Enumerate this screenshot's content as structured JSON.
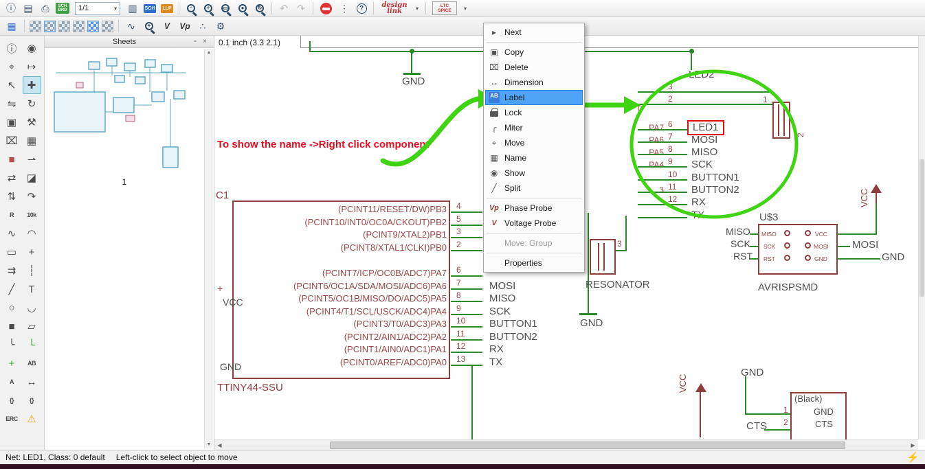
{
  "colors": {
    "wire_green": "#2a8a2a",
    "component_red": "#8f3e3e",
    "annotation_red": "#e01020",
    "highlight_green": "#3fd411",
    "menu_highlight_blue": "#4fa3f7"
  },
  "icons": {
    "caret": "▾",
    "bolt": "⚡",
    "scroll_up": "▲",
    "scroll_down": "▼",
    "scroll_left": "◀",
    "scroll_right": "▶",
    "panel_pin": "▫",
    "panel_close": "×"
  },
  "toolbar_top": {
    "icons_a": [
      {
        "g": "ⓘ",
        "n": "info-icon"
      },
      {
        "g": "▤",
        "n": "save-icon"
      },
      {
        "g": "⎙",
        "n": "print-icon"
      },
      {
        "g": "SCH BRD",
        "n": "sch-brd-icon",
        "cls": "schbrd"
      }
    ],
    "sheet_selector": "1/1",
    "icons_b": [
      {
        "g": "▥",
        "n": "columns-icon"
      },
      {
        "g": "SCH",
        "n": "sch-chip-icon",
        "cls": "chip chip-blue"
      },
      {
        "g": "LLP",
        "n": "llp-chip-icon",
        "cls": "chip chip-orange"
      }
    ],
    "icons_zoom": [
      {
        "g": "−",
        "n": "zoom-out-icon",
        "cls": "mag"
      },
      {
        "g": "+",
        "n": "zoom-in-icon",
        "cls": "mag"
      },
      {
        "g": "▭",
        "n": "zoom-window-icon",
        "cls": "mag"
      },
      {
        "g": "●",
        "n": "zoom-full-icon",
        "cls": "mag"
      },
      {
        "g": "↻",
        "n": "zoom-redraw-icon",
        "cls": "mag"
      }
    ],
    "icons_c": [
      {
        "g": "↶",
        "n": "undo-icon",
        "cls": "dis"
      },
      {
        "g": "↷",
        "n": "redo-icon",
        "cls": "dis"
      }
    ],
    "icons_d": [
      {
        "g": "",
        "n": "stop-icon",
        "cls": "stop"
      },
      {
        "g": "⋮",
        "n": "overflow-icon"
      },
      {
        "g": "?",
        "n": "help-icon",
        "cls": "help"
      }
    ],
    "design_link": "design link",
    "ltc_spice": "LTC SPICE"
  },
  "toolbar2": {
    "icons_a": [
      {
        "g": "▦",
        "n": "grid-icon",
        "cls": "blue"
      }
    ],
    "swatches": [
      {
        "n": "layer-view-1-icon"
      },
      {
        "n": "layer-view-2-icon",
        "cls": "pressed"
      },
      {
        "n": "layer-view-3-icon"
      },
      {
        "n": "layer-view-4-icon"
      },
      {
        "n": "layer-view-5-icon",
        "cls": "pressed sw-blue"
      },
      {
        "n": "layer-view-6-icon"
      }
    ],
    "icons_b": [
      {
        "g": "∿",
        "n": "signal-icon"
      },
      {
        "g": "+",
        "n": "zoom-probe-icon",
        "cls": "mag"
      },
      {
        "g": "V",
        "n": "voltage-probe-icon",
        "cls": "probe"
      },
      {
        "g": "Vp",
        "n": "phase-probe-icon",
        "cls": "probe"
      },
      {
        "g": "∴",
        "n": "chain-icon"
      },
      {
        "g": "⚙",
        "n": "settings-gear-icon"
      }
    ]
  },
  "palette": {
    "tools": [
      {
        "g": "ⓘ",
        "n": "info-tool"
      },
      {
        "g": "◉",
        "n": "show-tool"
      },
      {
        "g": "⌖",
        "n": "mark-tool"
      },
      {
        "g": "↦",
        "n": "display-tool"
      },
      {
        "g": "↖",
        "n": "select-tool"
      },
      {
        "g": "✚",
        "n": "move-tool",
        "cls": "active"
      },
      {
        "g": "⇋",
        "n": "mirror-tool"
      },
      {
        "g": "↻",
        "n": "rotate-tool"
      },
      {
        "g": "▣",
        "n": "copy-tool"
      },
      {
        "g": "⚒",
        "n": "change-tool"
      },
      {
        "g": "⌧",
        "n": "delete-tool"
      },
      {
        "g": "▦",
        "n": "group-tool"
      },
      {
        "g": "■",
        "n": "add-tool",
        "cls": "c-red"
      },
      {
        "g": "⇀",
        "n": "pinswap-tool"
      },
      {
        "g": "⇄",
        "n": "gateswap-tool"
      },
      {
        "g": "◪",
        "n": "lock-tool"
      },
      {
        "g": "⇅",
        "n": "invoke-tool"
      },
      {
        "g": "↷",
        "n": "paste-tool"
      },
      {
        "g": "R",
        "n": "replace-tool",
        "cls": "tiny"
      },
      {
        "g": "10k",
        "n": "value-tool",
        "cls": "tiny"
      },
      {
        "g": "∿",
        "n": "wire-tool"
      },
      {
        "g": "◠",
        "n": "arc-tool"
      },
      {
        "g": "▭",
        "n": "rect-tool"
      },
      {
        "g": "+",
        "n": "cross-tool"
      },
      {
        "g": "⇉",
        "n": "bus-tool"
      },
      {
        "g": "┆",
        "n": "dashline-tool"
      },
      {
        "g": "╱",
        "n": "line-tool"
      },
      {
        "g": "T",
        "n": "text-tool"
      },
      {
        "g": "○",
        "n": "circle-tool"
      },
      {
        "g": "◡",
        "n": "arc2-tool"
      },
      {
        "g": "■",
        "n": "fillrect-tool"
      },
      {
        "g": "▱",
        "n": "polygon-tool"
      },
      {
        "g": "╰",
        "n": "bend-tool"
      },
      {
        "g": "└",
        "n": "busentry-tool",
        "cls": "c-green"
      },
      {
        "g": "+",
        "n": "junction-tool",
        "cls": "c-green"
      },
      {
        "g": "AB",
        "n": "label-tool",
        "cls": "tiny"
      },
      {
        "g": "A",
        "n": "attribute-tool",
        "cls": "tiny"
      },
      {
        "g": "↔",
        "n": "dimension-tool"
      },
      {
        "g": "{}",
        "n": "smash-tool",
        "cls": "tiny"
      },
      {
        "g": "{}",
        "n": "unsmash-tool",
        "cls": "tiny"
      },
      {
        "g": "ERC",
        "n": "erc-tool",
        "cls": "tiny"
      },
      {
        "g": "⚠",
        "n": "errors-tool",
        "cls": "c-warn"
      }
    ]
  },
  "sheets_panel": {
    "title": "Sheets",
    "sheet_label": "1"
  },
  "canvas": {
    "coord": "0.1 inch (3.3 2.1)",
    "annotation": "To show the name ->Right click component"
  },
  "context_menu": {
    "items": [
      {
        "label": "Next",
        "icon": "▸",
        "n": "menu-item-next"
      },
      {
        "sep": true
      },
      {
        "label": "Copy",
        "icon": "▣",
        "n": "menu-item-copy"
      },
      {
        "label": "Delete",
        "icon": "⌧",
        "n": "menu-item-delete"
      },
      {
        "label": "Dimension",
        "icon": "↔",
        "n": "menu-item-dimension"
      },
      {
        "label": "Label",
        "icon": "AB",
        "cls": "highlight",
        "icls": "ic-ab",
        "n": "menu-item-label"
      },
      {
        "label": "Lock",
        "icls": "ic-lock",
        "n": "menu-item-lock"
      },
      {
        "label": "Miter",
        "icon": "╭",
        "n": "menu-item-miter"
      },
      {
        "label": "Move",
        "icon": "⌖",
        "n": "menu-item-move"
      },
      {
        "label": "Name",
        "icon": "▦",
        "n": "menu-item-name"
      },
      {
        "label": "Show",
        "icon": "◉",
        "n": "menu-item-show"
      },
      {
        "label": "Split",
        "icon": "╱",
        "n": "menu-item-split"
      },
      {
        "sep": true
      },
      {
        "label": "Phase Probe",
        "icon": "Vp",
        "icls": "ic-probe",
        "n": "menu-item-phase-probe"
      },
      {
        "label": "Voltage Probe",
        "icon": "V",
        "icls": "ic-probe",
        "n": "menu-item-voltage-probe"
      },
      {
        "sep": true
      },
      {
        "label": "Move: Group",
        "cls": "disabled",
        "n": "menu-item-move-group"
      },
      {
        "sep": true
      },
      {
        "label": "Properties",
        "n": "menu-item-properties"
      }
    ]
  },
  "schematic": {
    "top": {
      "gnd": "GND"
    },
    "ic1": {
      "ref": "C1",
      "name": "TTINY44-SSU",
      "plus": "+",
      "vcc": "VCC",
      "gnd": "GND",
      "pins": [
        {
          "num": "4",
          "label": "(PCINT11/RESET/DW)PB3",
          "net": ""
        },
        {
          "num": "5",
          "label": "(PCINT10/INT0/OC0A/CKOUT)PB2",
          "net": ""
        },
        {
          "num": "3",
          "label": "(PCINT9/XTAL2)PB1",
          "net": ""
        },
        {
          "num": "2",
          "label": "(PCINT8/XTAL1/CLKI)PB0",
          "net": ""
        },
        {
          "cls": "spacer-row"
        },
        {
          "num": "6",
          "label": "(PCINT7/ICP/OC0B/ADC7)PA7",
          "net": ""
        },
        {
          "num": "7",
          "label": "(PCINT6/OC1A/SDA/MOSI/ADC6)PA6",
          "net": "MOSI"
        },
        {
          "num": "8",
          "label": "(PCINT5/OC1B/MISO/DO/ADC5)PA5",
          "net": "MISO"
        },
        {
          "num": "9",
          "label": "(PCINT4/T1/SCL/USCK/ADC4)PA4",
          "net": "SCK"
        },
        {
          "num": "10",
          "label": "(PCINT3/T0/ADC3)PA3",
          "net": "BUTTON1"
        },
        {
          "num": "11",
          "label": "(PCINT2/AIN1/ADC2)PA2",
          "net": "BUTTON2"
        },
        {
          "num": "12",
          "label": "(PCINT1/AIN0/ADC1)PA1",
          "net": "RX"
        },
        {
          "num": "13",
          "label": "(PCINT0/AREF/ADC0)PA0",
          "net": "TX"
        }
      ]
    },
    "top_right": {
      "led2": "LED2",
      "zero": "0",
      "one": "1",
      "two": "2",
      "rows": [
        {
          "left": "",
          "num": "3",
          "net": "",
          "cls": "long"
        },
        {
          "left": "",
          "num": "2",
          "net": "",
          "cls": "long"
        },
        {
          "cls": "spacer-row"
        },
        {
          "left": "PA7",
          "num": "6",
          "net": "LED1",
          "cls": "boxed"
        },
        {
          "left": "PA6",
          "num": "7",
          "net": "MOSI"
        },
        {
          "left": "PA5",
          "num": "8",
          "net": "MISO"
        },
        {
          "left": "PA4",
          "num": "9",
          "net": "SCK"
        },
        {
          "left": "",
          "num": "10",
          "net": "BUTTON1"
        },
        {
          "left": "3",
          "num": "11",
          "net": "BUTTON2"
        },
        {
          "left": "",
          "num": "12",
          "net": "RX"
        },
        {
          "left": "",
          "num": "",
          "net": "TX"
        }
      ]
    },
    "resonator": {
      "name": "RESONATOR",
      "pin": "3",
      "gnd": "GND"
    },
    "isp": {
      "ref": "U$3",
      "name": "AVRISPSMD",
      "vcc": "VCC",
      "inner_left": [
        "MISO",
        "SCK",
        "RST"
      ],
      "inner_right": [
        "VCC",
        "MOSI",
        "GND"
      ],
      "ext_left": [
        "MISO",
        "SCK",
        "RST"
      ],
      "ext_mosi": "MOSI",
      "ext_gnd": "GND"
    },
    "bottom_right": {
      "vcc": "VCC",
      "gnd": "GND",
      "cts": "CTS",
      "comp_title": "(Black)",
      "pin1": "1",
      "pin2": "2",
      "comp_gnd": "GND",
      "comp_cts": "CTS"
    }
  },
  "status_bar": {
    "net_info": "Net: LED1, Class: 0 default",
    "hint": "Left-click to select object to move"
  }
}
